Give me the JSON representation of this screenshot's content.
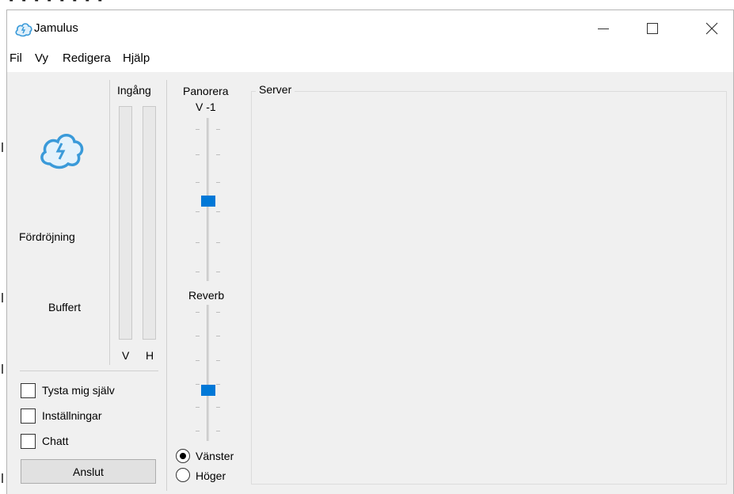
{
  "window": {
    "title": "Jamulus"
  },
  "menu": [
    "Fil",
    "Vy",
    "Redigera",
    "Hjälp"
  ],
  "left_panel": {
    "latency_label": "Fördröjning",
    "buffer_label": "Buffert",
    "input_label": "Ingång",
    "meter_left_label": "V",
    "meter_right_label": "H",
    "mute_self_label": "Tysta mig själv",
    "settings_label": "Inställningar",
    "chat_label": "Chatt",
    "connect_label": "Anslut"
  },
  "controls": {
    "pan_label": "Panorera",
    "pan_value": "V -1",
    "reverb_label": "Reverb",
    "reverb_left_label": "Vänster",
    "reverb_right_label": "Höger",
    "reverb_channel_selected": "Vänster"
  },
  "server": {
    "label": "Server"
  },
  "colors": {
    "slider_thumb": "#0078d7",
    "window_bg": "#f0f0f0"
  }
}
